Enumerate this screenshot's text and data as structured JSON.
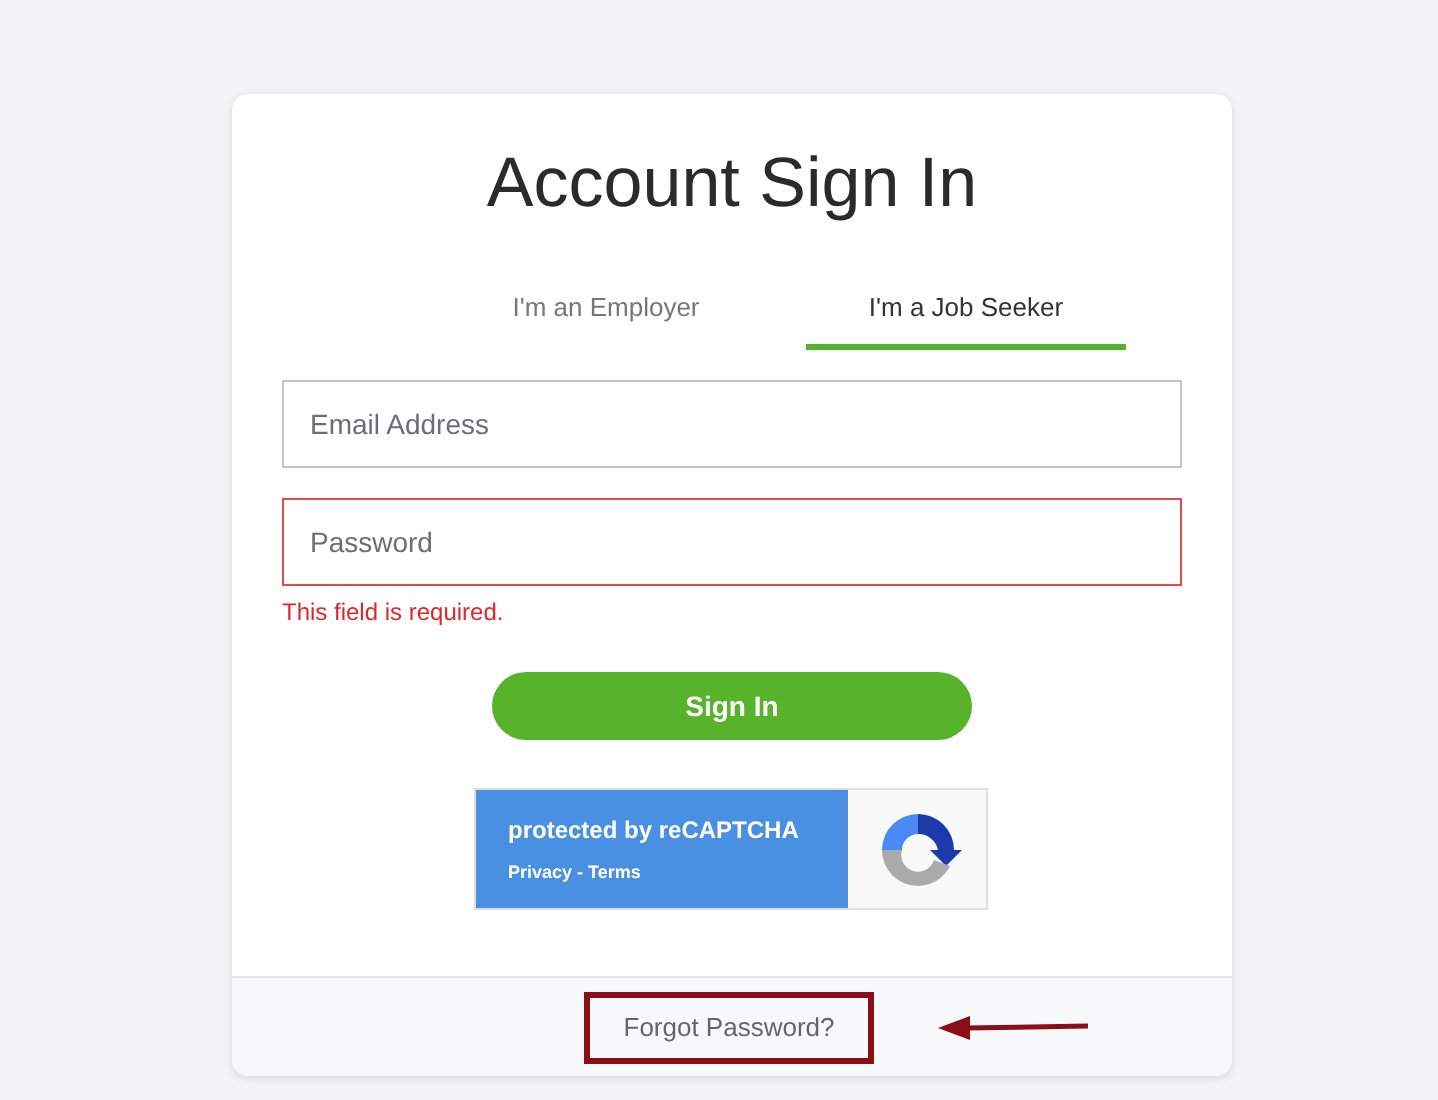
{
  "title": "Account Sign In",
  "tabs": [
    {
      "label": "I'm an Employer",
      "selected": false
    },
    {
      "label": "I'm a Job Seeker",
      "selected": true
    }
  ],
  "fields": [
    {
      "placeholder": "Email Address",
      "invalid": false
    },
    {
      "placeholder": "Password",
      "invalid": true,
      "error": "This field is required."
    }
  ],
  "sign_in_button": "Sign In",
  "recaptcha": {
    "title": "protected by reCAPTCHA",
    "links": "Privacy - Terms"
  },
  "footer": {
    "link": "Forgot Password?",
    "highlighted": true,
    "arrow": true
  }
}
